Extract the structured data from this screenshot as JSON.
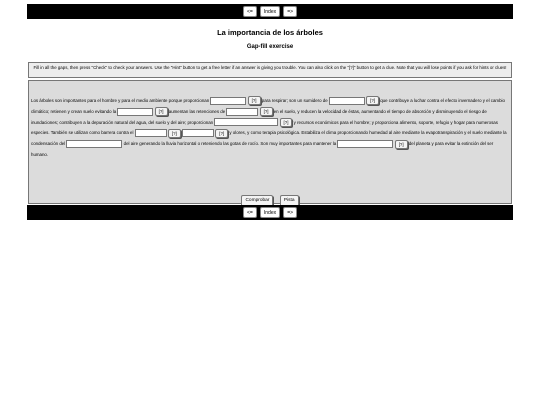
{
  "nav": {
    "prev": "<=",
    "index": "Index",
    "next": "=>"
  },
  "title": "La importancia de los árboles",
  "subtitle": "Gap-fill exercise",
  "instructions": "Fill in all the gaps, then press \"Check\" to check your answers. Use the \"Hint\" button to get a free letter if an answer is giving you trouble. You can also click on the \"[?]\" button to get a clue. Note that you will lose points if you ask for hints or clues!",
  "passage": {
    "t1": "Los árboles son importantes para el hombre y para el medio ambiente porque proporcionan ",
    "t2": " para respirar; son un sumidero de ",
    "t3": " que contribuye a luchar contra el efecto invernadero y el cambio climático; retienen y crean suelo evitando la ",
    "t4": " aumentan las retenciones de ",
    "t5": " en el suelo, y reducen la velocidad de éstas, aumentando el tiempo de absorción y disminuyendo el riesgo de inundaciones; contribuyen a la depuración natural del agua, del suelo y del aire; proporcionan ",
    "t6": " y recursos económicos para el hombre; y proporciona alimento, soporte, refugio y hogar para numerosas especies. También se utilizan como barrera contra el ",
    "t7": " y olores, y como terapia psicológica. Estabiliza el clima proporcionando humedad al aire mediante la evapotranspiración y el suelo mediante la condensación del ",
    "t8": " del aire generando la lluvia horizontal o reteniendo las gotas de rocío. Son muy importantes para mantener la ",
    "t9": " del planeta y para evitar la extinción del ser humano."
  },
  "clue_label": "[?]",
  "gaps": [
    "",
    "",
    "",
    "",
    "",
    "",
    "",
    ""
  ],
  "actions": {
    "check": "Comprobar",
    "hint": "Pista"
  }
}
